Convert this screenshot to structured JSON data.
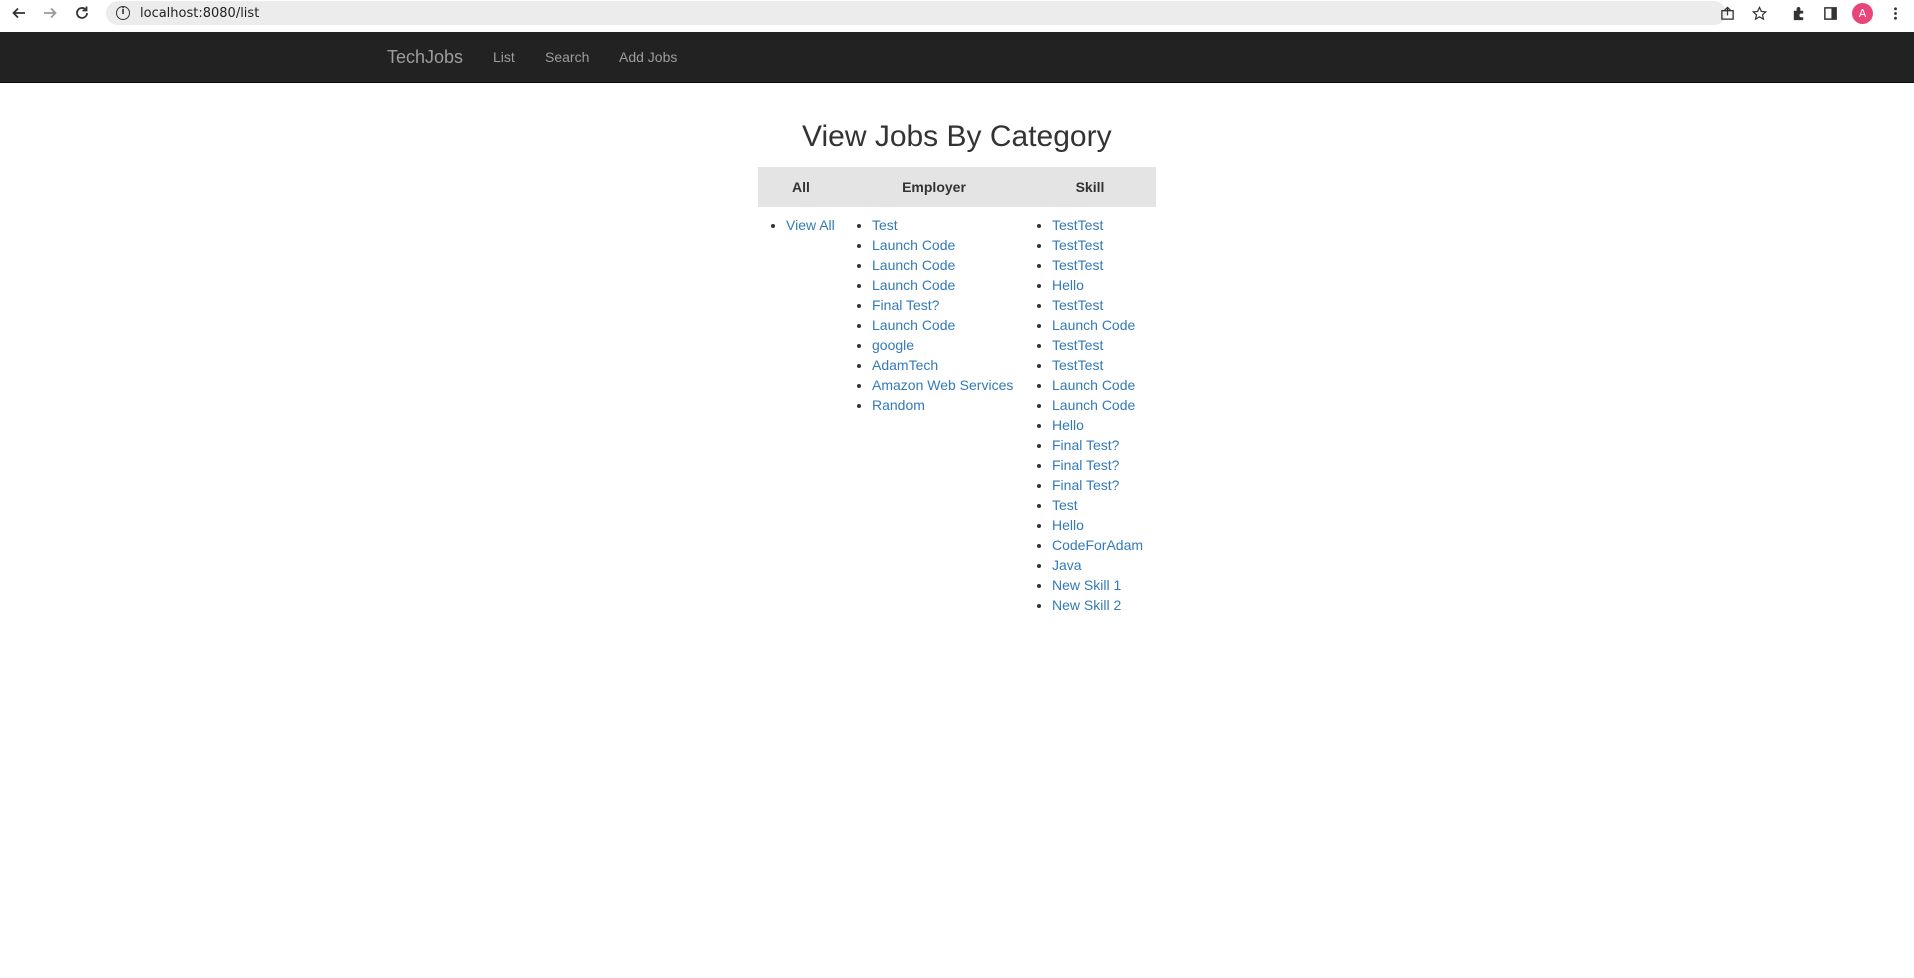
{
  "browser": {
    "url": "localhost:8080/list",
    "profile_initial": "A",
    "icons": [
      "back-icon",
      "forward-icon",
      "reload-icon",
      "info-icon",
      "share-icon",
      "star-icon",
      "extensions-icon",
      "sidebar-icon",
      "menu-icon"
    ]
  },
  "navbar": {
    "brand": "TechJobs",
    "links": [
      "List",
      "Search",
      "Add Jobs"
    ],
    "background": "#222222",
    "link_color": "#9d9d9d"
  },
  "page": {
    "title": "View Jobs By Category"
  },
  "table": {
    "headers": [
      "All",
      "Employer",
      "Skill"
    ],
    "header_background": "#e4e4e4",
    "link_color": "#337ab7",
    "all": [
      "View All"
    ],
    "employer": [
      "Test",
      "Launch Code",
      "Launch Code",
      "Launch Code",
      "Final Test?",
      "Launch Code",
      "google",
      "AdamTech",
      "Amazon Web Services",
      "Random"
    ],
    "skill": [
      "TestTest",
      "TestTest",
      "TestTest",
      "Hello",
      "TestTest",
      "Launch Code",
      "TestTest",
      "TestTest",
      "Launch Code",
      "Launch Code",
      "Hello",
      "Final Test?",
      "Final Test?",
      "Final Test?",
      "Test",
      "Hello",
      "CodeForAdam",
      "Java",
      "New Skill 1",
      "New Skill 2"
    ]
  }
}
